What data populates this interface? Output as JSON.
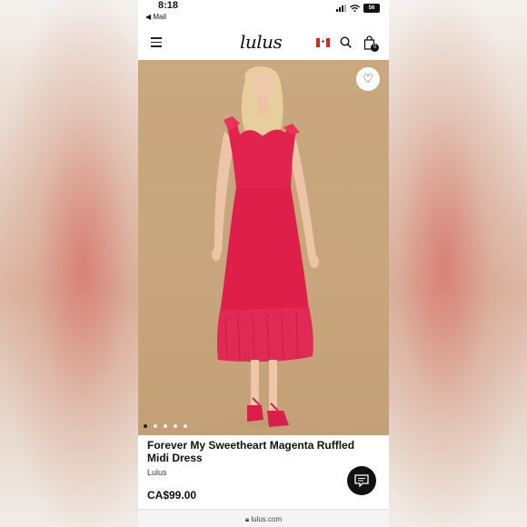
{
  "status_bar": {
    "time": "8:18",
    "back_app": "◀ Mail",
    "battery": "56"
  },
  "header": {
    "logo": "lulus",
    "cart_count": "0"
  },
  "product": {
    "title": "Forever My Sweetheart Magenta Ruffled Midi Dress",
    "brand": "Lulus",
    "price": "CA$99.00",
    "image_count": 5,
    "active_image": 0,
    "dress_color": "#e3234f"
  },
  "browser": {
    "url": "lulus.com"
  },
  "colors": {
    "background": "#c9a77f",
    "accent": "#111111"
  }
}
